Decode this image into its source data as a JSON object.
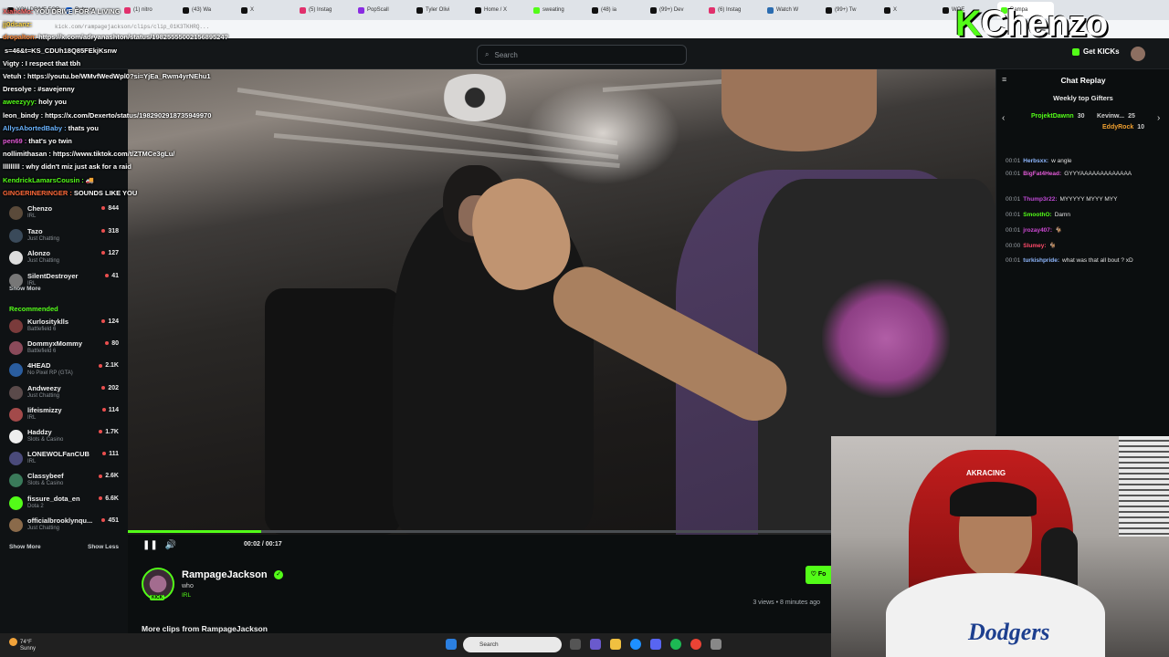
{
  "browser": {
    "tabs": [
      {
        "label": "YOU DRIVE FOR A LIVING",
        "color": "#111111"
      },
      {
        "label": "Ruby on",
        "color": "#1f6feb"
      },
      {
        "label": "(1) nitro",
        "color": "#e1306c"
      },
      {
        "label": "(43) Wa",
        "color": "#111111"
      },
      {
        "label": "X",
        "color": "#111111"
      },
      {
        "label": "(5) Instag",
        "color": "#e1306c"
      },
      {
        "label": "PopScall",
        "color": "#8a2be2"
      },
      {
        "label": "Tyler Olivi",
        "color": "#111111"
      },
      {
        "label": "Home / X",
        "color": "#111111"
      },
      {
        "label": "sweating",
        "color": "#53fc18"
      },
      {
        "label": "(48) ia",
        "color": "#111111"
      },
      {
        "label": "(99+) Dev",
        "color": "#111111"
      },
      {
        "label": "(6) Instag",
        "color": "#e1306c"
      },
      {
        "label": "Watch W",
        "color": "#2b6cb0"
      },
      {
        "label": "(99+) Tw",
        "color": "#111111"
      },
      {
        "label": "X",
        "color": "#111111"
      },
      {
        "label": "WOE",
        "color": "#111111"
      },
      {
        "label": "Rampa",
        "color": "#53fc18"
      }
    ],
    "url": "kick.com/rampagejackson/clips/clip_01K3TKHRQ..."
  },
  "topnav": {
    "search_placeholder": "Search",
    "get_kicks": "Get KICKs"
  },
  "sidebar": {
    "following": [
      {
        "name": "Chenzo",
        "category": "IRL",
        "viewers": "844",
        "color": "#5a4a3a"
      },
      {
        "name": "Tazo",
        "category": "Just Chatting",
        "viewers": "318",
        "color": "#3a4a5a"
      },
      {
        "name": "Alonzo",
        "category": "Just Chatting",
        "viewers": "127",
        "color": "#dddddd"
      },
      {
        "name": "SilentDestroyer",
        "category": "IRL",
        "viewers": "41",
        "color": "#777777"
      }
    ],
    "show_more": "Show More",
    "recommended_heading": "Recommended",
    "recommended": [
      {
        "name": "Kurlosityklls",
        "category": "Battlefield 6",
        "viewers": "124",
        "color": "#7a3b3b"
      },
      {
        "name": "DommyxMommy",
        "category": "Battlefield 6",
        "viewers": "80",
        "color": "#8a4a5a"
      },
      {
        "name": "4HEAD",
        "category": "No Pixel RP (GTA)",
        "viewers": "2.1K",
        "color": "#2a5d9f"
      },
      {
        "name": "Andweezy",
        "category": "Just Chatting",
        "viewers": "202",
        "color": "#5a4a4a"
      },
      {
        "name": "lifeismizzy",
        "category": "IRL",
        "viewers": "114",
        "color": "#a34a4a"
      },
      {
        "name": "Haddzy",
        "category": "Slots & Casino",
        "viewers": "1.7K",
        "color": "#eeeeee"
      },
      {
        "name": "LONEWOLFanCUB",
        "category": "IRL",
        "viewers": "111",
        "color": "#4a4a7a"
      },
      {
        "name": "Classybeef",
        "category": "Slots & Casino",
        "viewers": "2.6K",
        "color": "#3a7a5a"
      },
      {
        "name": "fissure_dota_en",
        "category": "Dota 2",
        "viewers": "6.6K",
        "color": "#53fc18"
      },
      {
        "name": "officialbrooklynqu...",
        "category": "Just Chatting",
        "viewers": "451",
        "color": "#8a6a4a"
      }
    ],
    "show_more_2": "Show More",
    "show_less": "Show Less"
  },
  "player": {
    "time": "00:02 / 00:17",
    "progress": 0.19
  },
  "clip": {
    "streamer": "RampageJackson",
    "title": "who",
    "category": "IRL",
    "views": "3 views • 8 minutes ago",
    "follow": "Fo",
    "more_clips": "More clips from RampageJackson"
  },
  "chat": {
    "title": "Chat Replay",
    "gifters_heading": "Weekly top Gifters",
    "gifters": [
      {
        "name": "ProjektDawnn",
        "count": "30",
        "color": "#53fc18"
      },
      {
        "name": "Kevinw...",
        "count": "25",
        "color": "#cfcfcf"
      },
      {
        "name": "EddyRock",
        "count": "10",
        "color": "#f0a030"
      }
    ],
    "messages": [
      {
        "time": "00:01",
        "user": "Herbsxx:",
        "text": "w angle",
        "color": "#8fb8ff"
      },
      {
        "time": "00:01",
        "user": "BigFat4Head:",
        "text": "GYYYAAAAAAAAAAAAA",
        "color": "#e15ad6"
      },
      {
        "time": "00:01",
        "user": "Thump3r22:",
        "text": "MYYYYY MYYY MYY",
        "color": "#c04ad6"
      },
      {
        "time": "00:01",
        "user": "SmoothO:",
        "text": "Damn",
        "color": "#53fc18"
      },
      {
        "time": "00:01",
        "user": "jrozay407:",
        "text": "🐐",
        "color": "#d04ad6"
      },
      {
        "time": "00:00",
        "user": "Slumey:",
        "text": "🐐",
        "color": "#ff4a6a"
      },
      {
        "time": "00:01",
        "user": "turkishpride:",
        "text": "what was that all bout ? xD",
        "color": "#8fb8ff"
      }
    ]
  },
  "overlay": {
    "chat": [
      {
        "user": "XiahcMo:",
        "text": "YOU DRIVE FOR A LIVING",
        "color": "#ff6a6a"
      },
      {
        "user": "jj0dsanz:",
        "text": "",
        "color": "#ffd84a"
      },
      {
        "user": "dropalton:",
        "text": "https://x.com/adryanashton/status/1982555500215689524?",
        "color": "#ff8a3a"
      },
      {
        "user": "",
        "text": "s=46&t=KS_CDUh18Q85FEkjKsnw",
        "color": "#ffffff"
      },
      {
        "user": "Vigty :",
        "text": "I respect that tbh",
        "color": "#ffffff"
      },
      {
        "user": "Vetuh :",
        "text": "https://youtu.be/WMvfWedWpl0?si=YjEa_Rwm4yrNEhu1",
        "color": "#ffffff"
      },
      {
        "user": "Dresolye :",
        "text": "#savejenny",
        "color": "#ffffff"
      },
      {
        "user": "aweezyyy:",
        "text": "holy you",
        "color": "#53fc18"
      },
      {
        "user": "leon_bindy :",
        "text": "https://x.com/Dexerto/status/1982902918735949970",
        "color": "#ffffff"
      },
      {
        "user": "AllysAbortedBaby :",
        "text": "thats you",
        "color": "#6ab4ff"
      },
      {
        "user": "pen69 :",
        "text": "that's yo twin",
        "color": "#e15ad6"
      },
      {
        "user": "nollimithasan :",
        "text": "https://www.tiktok.com/t/ZTMCe3gLu/",
        "color": "#ffffff"
      },
      {
        "user": "lllllllll :",
        "text": "why didn't miz just ask for a raid",
        "color": "#ffffff"
      },
      {
        "user": "KendrickLamarsCousin :",
        "text": "🚚",
        "color": "#53fc18"
      },
      {
        "user": "GINGERINERINGER :",
        "text": "SOUNDS LIKE YOU",
        "color": "#ff6a3a"
      }
    ],
    "logo": "Chenzo"
  },
  "taskbar": {
    "weather_temp": "74°F",
    "weather_desc": "Sunny",
    "search": "Search"
  }
}
